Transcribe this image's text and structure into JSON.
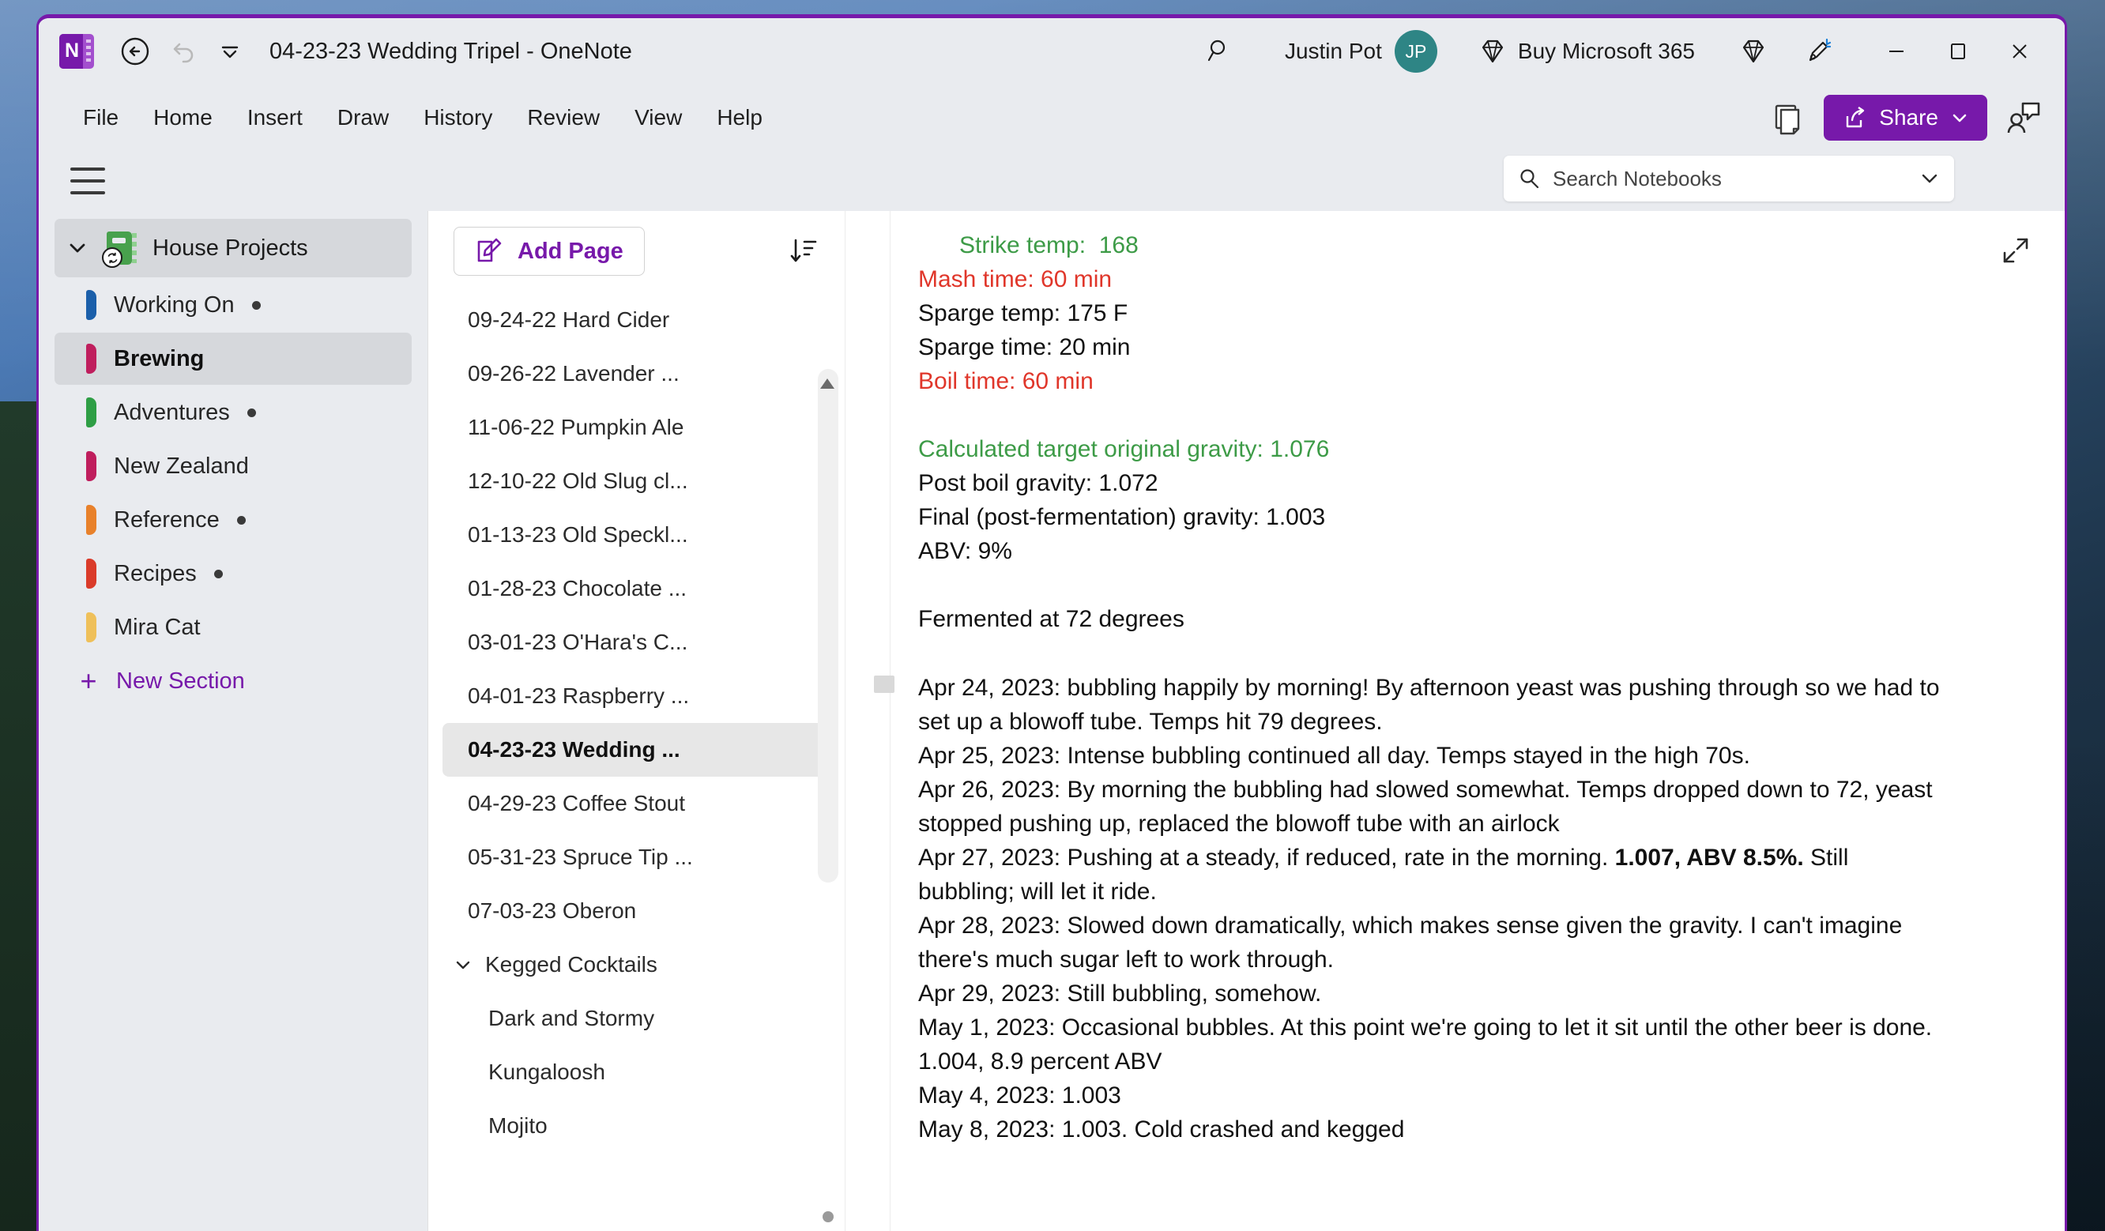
{
  "titlebar": {
    "app_icon_letter": "N",
    "back_icon": "back-arrow-icon",
    "undo_icon": "undo-icon",
    "quick_access_icon": "chevron-down-icon",
    "document_title": "04-23-23 Wedding Tripel  -  OneNote",
    "search_icon": "search-icon",
    "user_name": "Justin Pot",
    "avatar_initials": "JP",
    "buy_label": "Buy Microsoft 365",
    "diamond_icon": "diamond-icon",
    "pen_icon": "pen-sparkle-icon",
    "minimize": "minimize-icon",
    "maximize": "maximize-icon",
    "close": "close-icon"
  },
  "ribbon": {
    "menu": [
      "File",
      "Home",
      "Insert",
      "Draw",
      "History",
      "Review",
      "View",
      "Help"
    ],
    "sticky_notes_icon": "sticky-notes-icon",
    "share_label": "Share",
    "share_icon": "share-icon",
    "share_chevron": "chevron-down-icon",
    "people_icon": "person-comment-icon",
    "accent_color": "#7719aa"
  },
  "search": {
    "hamburger_icon": "hamburger-menu-icon",
    "search_icon": "search-icon",
    "placeholder": "Search Notebooks",
    "value": "",
    "dropdown_icon": "chevron-down-icon"
  },
  "sidebar": {
    "notebook": {
      "label": "House Projects",
      "expand_icon": "chevron-down-icon",
      "notebook_icon": "notebook-icon",
      "sync_icon": "sync-icon",
      "color": "#48a14d"
    },
    "sections": [
      {
        "label": "Working On",
        "color": "#1b5faa",
        "unread": true,
        "selected": false
      },
      {
        "label": "Brewing",
        "color": "#bf1e5d",
        "unread": false,
        "selected": true
      },
      {
        "label": "Adventures",
        "color": "#2e9e45",
        "unread": true,
        "selected": false
      },
      {
        "label": "New Zealand",
        "color": "#bf1e5d",
        "unread": false,
        "selected": false
      },
      {
        "label": "Reference",
        "color": "#e8812b",
        "unread": true,
        "selected": false
      },
      {
        "label": "Recipes",
        "color": "#da3b2a",
        "unread": true,
        "selected": false
      },
      {
        "label": "Mira Cat",
        "color": "#efc05a",
        "unread": false,
        "selected": false
      }
    ],
    "new_section_label": "New Section",
    "new_section_icon": "plus-icon"
  },
  "pagelist": {
    "add_page_label": "Add Page",
    "add_page_icon": "edit-page-icon",
    "sort_icon": "sort-descending-icon",
    "pages": [
      {
        "label": "09-24-22 Hard Cider",
        "selected": false
      },
      {
        "label": "09-26-22 Lavender ...",
        "selected": false
      },
      {
        "label": "11-06-22 Pumpkin Ale",
        "selected": false
      },
      {
        "label": "12-10-22 Old Slug cl...",
        "selected": false
      },
      {
        "label": "01-13-23 Old Speckl...",
        "selected": false
      },
      {
        "label": "01-28-23 Chocolate ...",
        "selected": false
      },
      {
        "label": "03-01-23 O'Hara's C...",
        "selected": false
      },
      {
        "label": "04-01-23 Raspberry ...",
        "selected": false
      },
      {
        "label": "04-23-23 Wedding ...",
        "selected": true
      },
      {
        "label": "04-29-23 Coffee Stout",
        "selected": false
      },
      {
        "label": "05-31-23 Spruce Tip ...",
        "selected": false
      },
      {
        "label": "07-03-23 Oberon",
        "selected": false
      }
    ],
    "group": {
      "label": "Kegged Cocktails",
      "expand_icon": "chevron-down-icon",
      "pages": [
        {
          "label": "Dark and Stormy"
        },
        {
          "label": "Kungaloosh"
        },
        {
          "label": "Mojito"
        }
      ]
    }
  },
  "note": {
    "expand_icon": "expand-icon",
    "lines": [
      {
        "text": "Strike temp:  168",
        "color": "green",
        "indent": true
      },
      {
        "text": "Mash time: 60 min",
        "color": "red",
        "indent": false
      },
      {
        "text": "Sparge temp: 175 F",
        "color": "black",
        "indent": false
      },
      {
        "text": "Sparge time: 20 min",
        "color": "black",
        "indent": false
      },
      {
        "text": "Boil time: 60 min",
        "color": "red",
        "indent": false
      },
      {
        "text": "",
        "color": "black",
        "indent": false
      },
      {
        "text": "Calculated target original gravity: 1.076",
        "color": "green",
        "indent": false
      },
      {
        "text": "Post boil gravity: 1.072",
        "color": "black",
        "indent": false
      },
      {
        "text": "Final (post-fermentation) gravity: 1.003",
        "color": "black",
        "indent": false
      },
      {
        "text": "ABV: 9%",
        "color": "black",
        "indent": false
      },
      {
        "text": "",
        "color": "black",
        "indent": false
      },
      {
        "text": "Fermented at 72 degrees",
        "color": "black",
        "indent": false
      }
    ],
    "journal": [
      {
        "text": "Apr 24, 2023: bubbling happily by morning! By afternoon yeast was pushing through so we had to set up a blowoff tube. Temps hit 79 degrees."
      },
      {
        "text": "Apr 25, 2023: Intense bubbling continued all day. Temps stayed in the high 70s."
      },
      {
        "text": "Apr 26, 2023: By morning the bubbling had slowed somewhat. Temps dropped down to 72, yeast stopped pushing up, replaced the blowoff tube with an airlock"
      },
      {
        "pre": "Apr 27, 2023: Pushing at a steady, if reduced, rate in the morning. ",
        "bold": "1.007, ABV 8.5%.",
        "post": " Still bubbling; will let it ride."
      },
      {
        "text": "Apr 28, 2023: Slowed down dramatically, which makes sense given the gravity. I can't imagine there's much sugar left to work through."
      },
      {
        "text": "Apr 29, 2023: Still bubbling, somehow."
      },
      {
        "text": "May 1, 2023: Occasional bubbles. At this point we're going to let it sit until the other beer is done. 1.004, 8.9 percent ABV"
      },
      {
        "text": "May 4, 2023: 1.003"
      },
      {
        "text": "May 8, 2023: 1.003. Cold crashed and kegged"
      }
    ]
  }
}
